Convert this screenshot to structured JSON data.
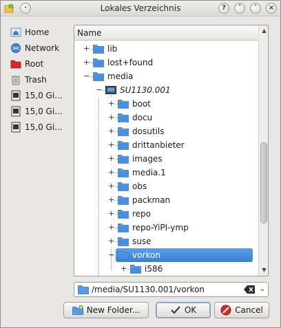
{
  "window": {
    "title": "Lokales Verzeichnis"
  },
  "places": [
    {
      "label": "Home",
      "icon": "home-icon"
    },
    {
      "label": "Network",
      "icon": "network-icon"
    },
    {
      "label": "Root",
      "icon": "root-folder-icon"
    },
    {
      "label": "Trash",
      "icon": "trash-icon"
    },
    {
      "label": "15,0 Gi...",
      "icon": "drive-icon"
    },
    {
      "label": "15,0 Gi...",
      "icon": "drive-icon"
    },
    {
      "label": "15,0 Gi...",
      "icon": "drive-icon"
    }
  ],
  "tree": {
    "header": "Name",
    "rows": [
      {
        "label": "lib"
      },
      {
        "label": "lost+found"
      },
      {
        "label": "media"
      },
      {
        "label": "SU1130.001"
      },
      {
        "label": "boot"
      },
      {
        "label": "docu"
      },
      {
        "label": "dosutils"
      },
      {
        "label": "drittanbieter"
      },
      {
        "label": "images"
      },
      {
        "label": "media.1"
      },
      {
        "label": "obs"
      },
      {
        "label": "packman"
      },
      {
        "label": "repo"
      },
      {
        "label": "repo-YiPI-ymp"
      },
      {
        "label": "suse"
      },
      {
        "label": "vorkon",
        "selected": true
      },
      {
        "label": "i586"
      }
    ]
  },
  "path": {
    "value": "/media/SU1130.001/vorkon"
  },
  "buttons": {
    "new_folder": "New Folder...",
    "ok": "OK",
    "cancel": "Cancel"
  },
  "colors": {
    "selection": "#3d7fcf",
    "folder": "#4a90d9"
  }
}
